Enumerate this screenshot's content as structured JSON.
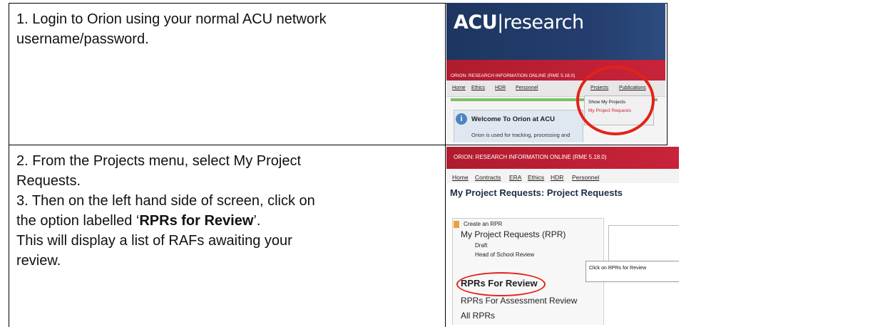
{
  "steps": [
    {
      "text": "1. Login to Orion using your normal ACU network username/password."
    },
    {
      "lines": [
        "2. From the Projects menu, select My Project",
        "Requests.",
        "3. Then on the left hand side of screen, click on",
        "This will display a list of RAFs awaiting your",
        "review."
      ],
      "option_prefix": "the option labelled ‘",
      "option_bold": "RPRs for Review",
      "option_suffix": "’."
    }
  ],
  "screenshot1": {
    "logo_main": "ACU",
    "logo_sep": "|",
    "logo_sub": "research",
    "redbar": "ORION: RESEARCH INFORMATION ONLINE (RME 5.18.0)",
    "menu": [
      "Home",
      "Ethics",
      "HDR",
      "Personnel",
      "Projects",
      "Publications"
    ],
    "dropdown": [
      "Show My Projects",
      "My Project Requests"
    ],
    "welcome_title": "Welcome To Orion at ACU",
    "welcome_body": "Orion is used for tracking, processing and",
    "info_icon": "i",
    "colors": {
      "banner": "#1d3661",
      "redbar": "#c8233a",
      "highlight": "#e32219"
    }
  },
  "screenshot2": {
    "redbar": "ORION: RESEARCH INFORMATION ONLINE (RME 5.18.0)",
    "menu": [
      "Home",
      "Contracts",
      "ERA",
      "Ethics",
      "HDR",
      "Personnel"
    ],
    "heading": "My Project Requests: Project Requests",
    "create": "Create an RPR",
    "my_requests": "My Project Requests (RPR)",
    "draft": "Draft",
    "head_review": "Head of School Review",
    "for_review": "RPRs For Review",
    "assessment": "RPRs For Assessment Review",
    "all": "All RPRs",
    "tooltip": "Click on RPRs for Review"
  }
}
